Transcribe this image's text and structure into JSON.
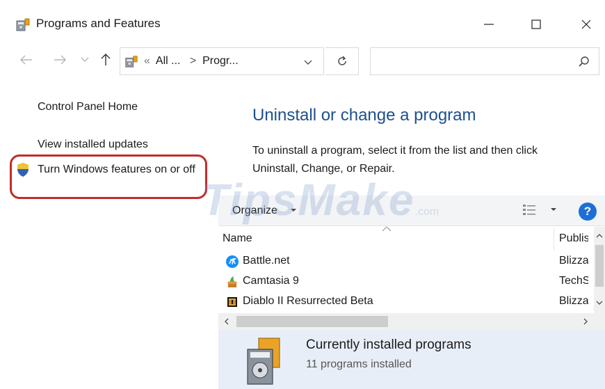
{
  "window": {
    "title": "Programs and Features",
    "icon": "programs-features-icon"
  },
  "address": {
    "crumb_prefix": "«",
    "crumb_all": "All ...",
    "separator": ">",
    "crumb_current": "Progr...",
    "search_placeholder": ""
  },
  "sidebar": {
    "home": "Control Panel Home",
    "updates": "View installed updates",
    "features": "Turn Windows features on or off"
  },
  "main": {
    "heading": "Uninstall or change a program",
    "description": "To uninstall a program, select it from the list and then click Uninstall, Change, or Repair."
  },
  "toolbar": {
    "organize": "Organize",
    "help": "?"
  },
  "watermark": {
    "text": "TipsMake",
    "suffix": ".com"
  },
  "table": {
    "columns": [
      "Name",
      "Publish"
    ],
    "rows": [
      {
        "name": "Battle.net",
        "publisher": "Blizzard",
        "icon": "battlenet-icon"
      },
      {
        "name": "Camtasia 9",
        "publisher": "TechSmith",
        "icon": "camtasia-icon"
      },
      {
        "name": "Diablo II Resurrected Beta",
        "publisher": "Blizzard",
        "icon": "diablo-icon"
      }
    ]
  },
  "details": {
    "title": "Currently installed programs",
    "count": "11 programs installed"
  },
  "colors": {
    "heading_blue": "#1e4f8c",
    "highlight_red": "#c42a2a",
    "help_blue": "#1d6fd6",
    "details_bg": "#e8eef8"
  }
}
